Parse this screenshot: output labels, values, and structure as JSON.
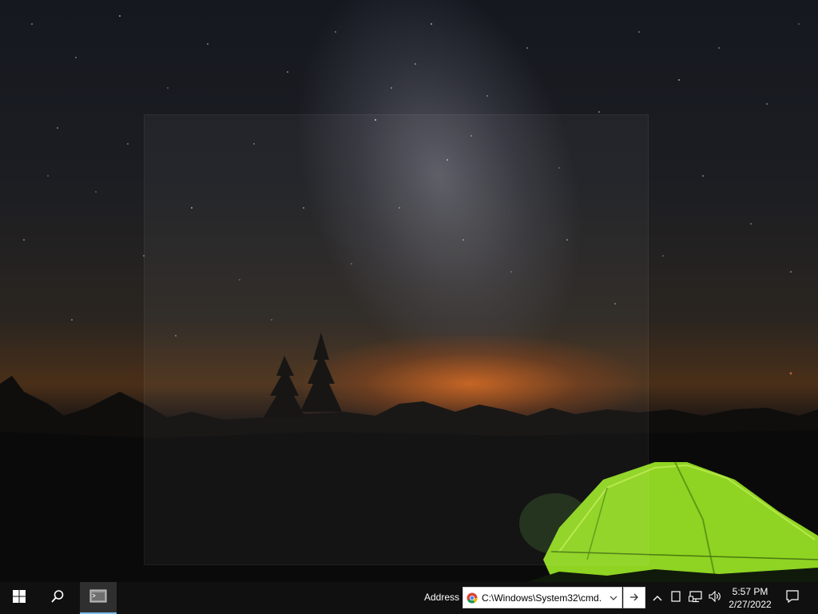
{
  "desktop": {
    "wallpaper": "night sky with milky way over mountains and a green tent"
  },
  "taskbar": {
    "start_icon": "windows-logo-icon",
    "search_icon": "search-icon",
    "app_icon": "command-prompt-icon",
    "address_label": "Address",
    "address_value": "C:\\Windows\\System32\\cmd.",
    "address_dropdown_icon": "chevron-down-icon",
    "address_favicon": "chrome-icon",
    "go_icon": "arrow-right-icon",
    "tray": {
      "chevron_icon": "chevron-up-icon",
      "icon_a": "tablet-icon",
      "network_icon": "network-icon",
      "volume_icon": "volume-icon"
    },
    "clock": {
      "time": "5:57 PM",
      "date": "2/27/2022"
    },
    "notification_icon": "notification-icon"
  },
  "colors": {
    "taskbar_bg": "#101010",
    "active_indicator": "#76b9ed",
    "tent_green": "#9be02a",
    "horizon_orange": "#e86e1e"
  }
}
